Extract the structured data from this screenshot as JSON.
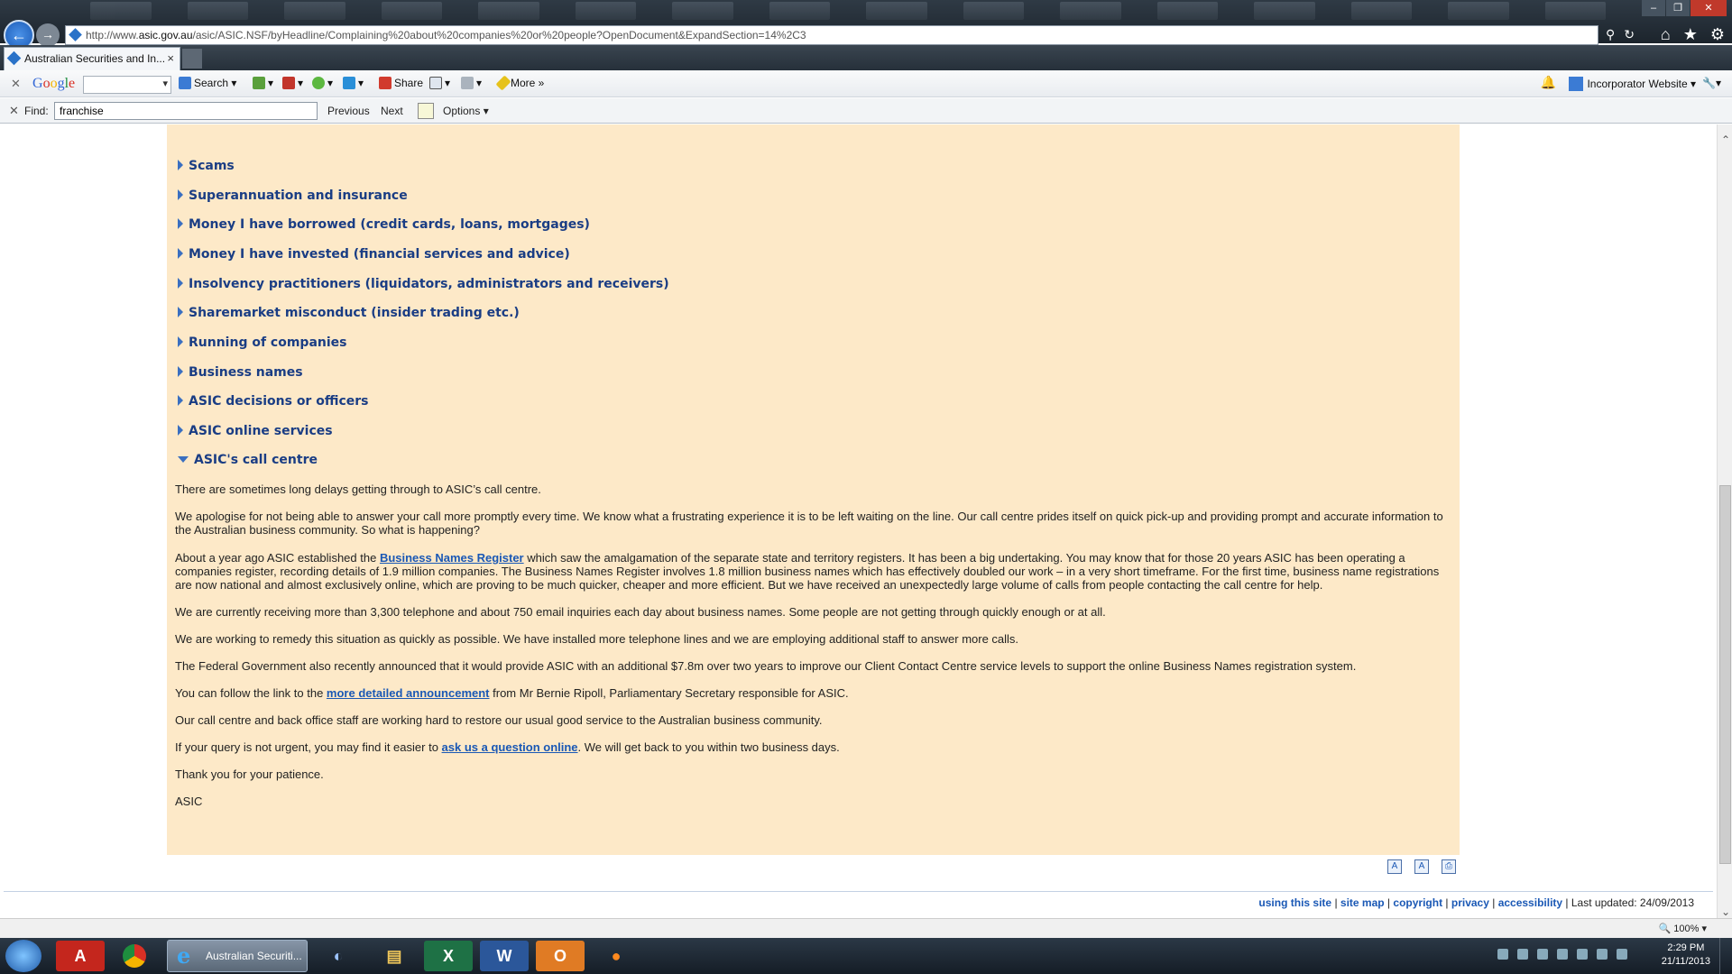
{
  "browser": {
    "url_prefix": "http://www.",
    "url_host": "asic.gov.au",
    "url_rest": "/asic/ASIC.NSF/byHeadline/Complaining%20about%20companies%20or%20people?OpenDocument&ExpandSection=14%2C3",
    "tab_title": "Australian Securities and In...",
    "tab_close": "×"
  },
  "toolbar": {
    "google": [
      "G",
      "o",
      "o",
      "g",
      "l",
      "e"
    ],
    "search_label": "Search",
    "share_label": "Share",
    "more_label": "More »",
    "account_label": "Incorporator Website ▾"
  },
  "findbar": {
    "label": "Find:",
    "value": "franchise",
    "previous": "Previous",
    "next": "Next",
    "options": "Options ▾"
  },
  "sections": [
    {
      "label": "Scams"
    },
    {
      "label": "Superannuation and insurance"
    },
    {
      "label": "Money I have borrowed (credit cards, loans, mortgages)"
    },
    {
      "label": "Money I have invested (financial services and advice)"
    },
    {
      "label": "Insolvency practitioners (liquidators, administrators and receivers)"
    },
    {
      "label": "Sharemarket misconduct (insider trading etc.)"
    },
    {
      "label": "Running of companies"
    },
    {
      "label": "Business names"
    },
    {
      "label": "ASIC decisions or officers"
    },
    {
      "label": "ASIC online services"
    },
    {
      "label": "ASIC's call centre"
    }
  ],
  "article": {
    "p1": "There are sometimes long delays getting through to ASIC’s call centre.",
    "p2": "We apologise for not being able to answer your call more promptly every time. We know what a frustrating experience it is to be left waiting on the line. Our call centre prides itself on quick pick-up and providing prompt and accurate information to the Australian business community. So what is happening?",
    "p3_a": "About a year ago ASIC established the ",
    "p3_link": "Business Names Register",
    "p3_b": " which saw the amalgamation of the separate state and territory registers. It has been a big undertaking. You may know that for those 20 years ASIC has been operating a companies register, recording details of 1.9 million companies. The Business Names Register involves 1.8 million business names which has effectively doubled our work – in a very short timeframe. For the first time, business name registrations are now national and almost exclusively online, which are proving to be much quicker, cheaper and more efficient. But we have received an unexpectedly large volume of calls from people contacting the call centre for help.",
    "p4": "We are currently receiving more than 3,300 telephone and about 750 email inquiries each day about business names. Some people are not getting through quickly enough or at all.",
    "p5": "We are working to remedy this situation as quickly as possible. We have installed more telephone lines and we are employing additional staff to answer more calls.",
    "p6": "The Federal Government also recently announced that it would provide ASIC with an additional $7.8m over two years to improve our Client Contact Centre service levels to support the online Business Names registration system.",
    "p7_a": "You can follow the link to the ",
    "p7_link": "more detailed announcement",
    "p7_b": " from Mr Bernie Ripoll, Parliamentary Secretary responsible for ASIC.",
    "p8": "Our call centre and back office staff are working hard to restore our usual good service to the Australian business community.",
    "p9_a": "If your query is not urgent, you may find it easier to ",
    "p9_link": "ask us a question online",
    "p9_b": ". We will get back to you within two business days.",
    "p10": "Thank you for your patience.",
    "p11": "ASIC"
  },
  "footer": {
    "using": "using this site",
    "sitemap": "site map",
    "copyright": "copyright",
    "privacy": "privacy",
    "accessibility": "accessibility",
    "sep": " | ",
    "updated": "Last updated: 24/09/2013"
  },
  "status": {
    "zoom": "🔍 100%  ▾"
  },
  "taskbar": {
    "ie_label": "Australian Securiti...",
    "time": "2:29 PM",
    "date": "21/11/2013"
  },
  "colors": {
    "panel_bg": "#fde9c8",
    "heading": "#1a3d84",
    "link": "#1a58b5"
  }
}
